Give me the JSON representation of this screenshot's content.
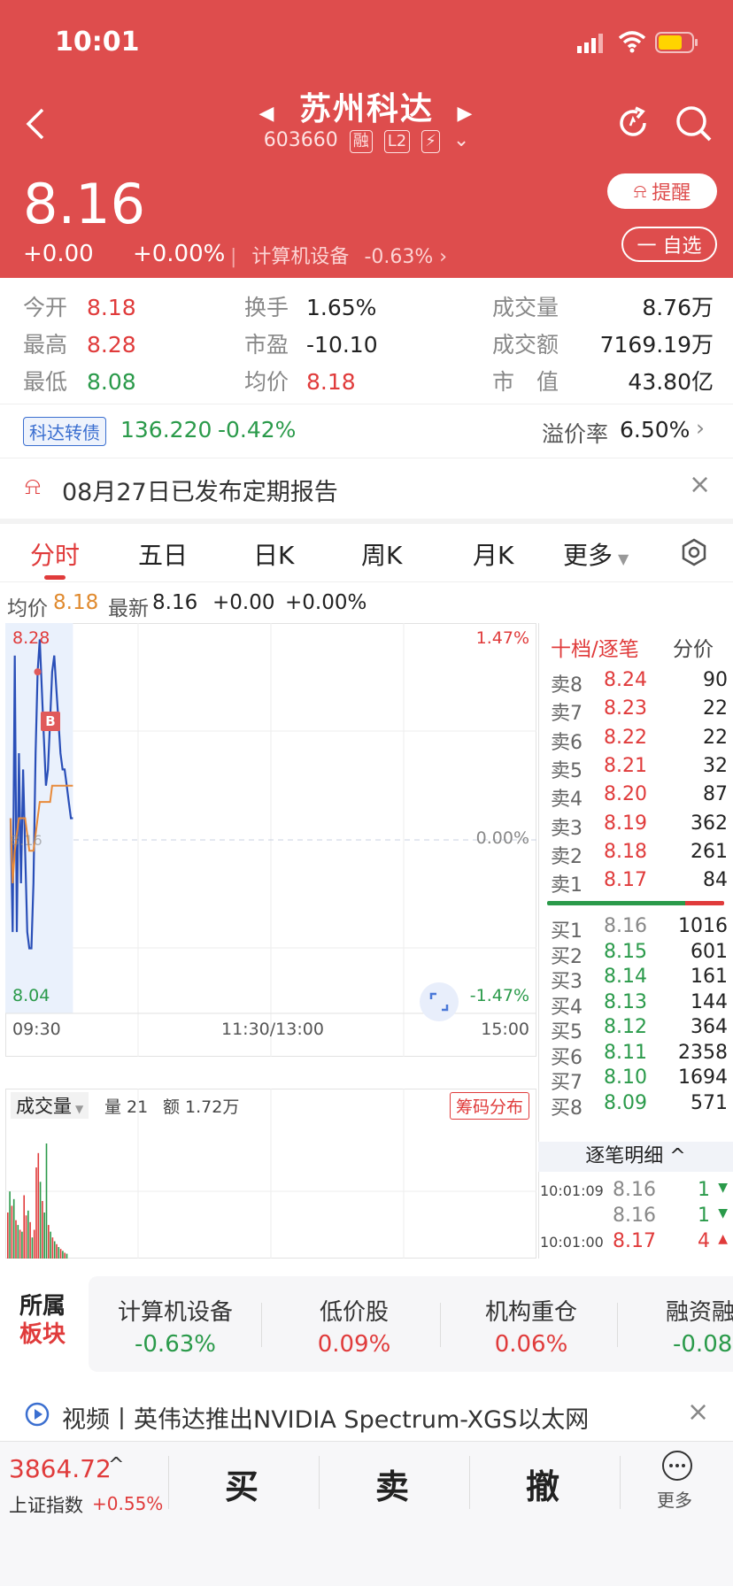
{
  "status": {
    "time": "10:01"
  },
  "header": {
    "name": "苏州科达",
    "code": "603660",
    "tags": [
      "融",
      "L2",
      "⚡"
    ],
    "price": "8.16",
    "change": "+0.00",
    "change_pct": "+0.00%",
    "sector": "计算机设备",
    "sector_pct": "-0.63%",
    "remind_label": "提醒",
    "watch_label": "一 自选"
  },
  "stats": {
    "open_k": "今开",
    "open_v": "8.18",
    "high_k": "最高",
    "high_v": "8.28",
    "low_k": "最低",
    "low_v": "8.08",
    "turnover_k": "换手",
    "turnover_v": "1.65%",
    "pe_k": "市盈",
    "pe_v": "-10.10",
    "avg_k": "均价",
    "avg_v": "8.18",
    "volume_k": "成交量",
    "volume_v": "8.76万",
    "amount_k": "成交额",
    "amount_v": "7169.19万",
    "mcap_k": "市　值",
    "mcap_v": "43.80亿"
  },
  "convertible": {
    "tag": "科达转债",
    "price": "136.220",
    "pct": "-0.42%",
    "premium_k": "溢价率",
    "premium_v": "6.50%"
  },
  "notice": {
    "text": "08月27日已发布定期报告"
  },
  "tabs": [
    "分时",
    "五日",
    "日K",
    "周K",
    "月K",
    "更多"
  ],
  "avgline": {
    "avg_k": "均价",
    "avg_v": "8.18",
    "last_k": "最新",
    "last_v": "8.16",
    "chg": "+0.00",
    "pct": "+0.00%"
  },
  "chart": {
    "top_price": "8.28",
    "bottom_price": "8.04",
    "top_pct": "1.47%",
    "bottom_pct": "-1.47%",
    "mid_pct": "0.00%",
    "mid_price": "8.16",
    "time_start": "09:30",
    "time_mid": "11:30/13:00",
    "time_end": "15:00",
    "marker": "B"
  },
  "chart_data": {
    "type": "line",
    "ylim": [
      8.04,
      8.28
    ],
    "x": [
      0,
      1,
      2,
      3,
      4,
      5,
      6,
      7,
      8,
      9,
      10,
      11,
      12,
      13,
      14,
      15,
      16,
      17,
      18,
      19,
      20,
      21,
      22,
      23,
      24,
      25,
      26,
      27,
      28,
      29,
      30
    ],
    "series": [
      {
        "values": [
          8.16,
          8.09,
          8.26,
          8.09,
          8.2,
          8.12,
          8.19,
          8.14,
          8.09,
          8.08,
          8.08,
          8.12,
          8.2,
          8.25,
          8.27,
          8.24,
          8.21,
          8.18,
          8.19,
          8.22,
          8.25,
          8.26,
          8.24,
          8.22,
          8.2,
          8.19,
          8.19,
          8.18,
          8.17,
          8.16,
          8.16
        ]
      },
      {
        "values": [
          8.16,
          8.12,
          8.14,
          8.15,
          8.16,
          8.16,
          8.16,
          8.16,
          8.15,
          8.14,
          8.14,
          8.14,
          8.15,
          8.16,
          8.17,
          8.17,
          8.17,
          8.17,
          8.17,
          8.17,
          8.18,
          8.18,
          8.18,
          8.18,
          8.18,
          8.18,
          8.18,
          8.18,
          8.18,
          8.18,
          8.18
        ]
      }
    ]
  },
  "volume": {
    "label": "成交量",
    "qty": "量 21",
    "amt": "额 1.72万",
    "chip_btn": "筹码分布",
    "bars": [
      48,
      70,
      55,
      62,
      40,
      35,
      30,
      28,
      66,
      45,
      50,
      38,
      22,
      30,
      95,
      110,
      80,
      60,
      48,
      120,
      35,
      28,
      22,
      18,
      15,
      12,
      10,
      8,
      6,
      5
    ],
    "colors": [
      "r",
      "g",
      "r",
      "g",
      "r",
      "g",
      "r",
      "g",
      "r",
      "r",
      "g",
      "r",
      "g",
      "r",
      "r",
      "r",
      "g",
      "r",
      "g",
      "g",
      "r",
      "g",
      "r",
      "g",
      "r",
      "g",
      "r",
      "g",
      "r",
      "g"
    ]
  },
  "orderbook": {
    "title": "十档/逐笔",
    "side": "分价",
    "asks": [
      {
        "k": "卖8",
        "p": "8.24",
        "v": "90"
      },
      {
        "k": "卖7",
        "p": "8.23",
        "v": "22"
      },
      {
        "k": "卖6",
        "p": "8.22",
        "v": "22"
      },
      {
        "k": "卖5",
        "p": "8.21",
        "v": "32"
      },
      {
        "k": "卖4",
        "p": "8.20",
        "v": "87"
      },
      {
        "k": "卖3",
        "p": "8.19",
        "v": "362"
      },
      {
        "k": "卖2",
        "p": "8.18",
        "v": "261"
      },
      {
        "k": "卖1",
        "p": "8.17",
        "v": "84"
      }
    ],
    "bids": [
      {
        "k": "买1",
        "p": "8.16",
        "v": "1016"
      },
      {
        "k": "买2",
        "p": "8.15",
        "v": "601"
      },
      {
        "k": "买3",
        "p": "8.14",
        "v": "161"
      },
      {
        "k": "买4",
        "p": "8.13",
        "v": "144"
      },
      {
        "k": "买5",
        "p": "8.12",
        "v": "364"
      },
      {
        "k": "买6",
        "p": "8.11",
        "v": "2358"
      },
      {
        "k": "买7",
        "p": "8.10",
        "v": "1694"
      },
      {
        "k": "买8",
        "p": "8.09",
        "v": "571"
      }
    ],
    "detail_label": "逐笔明细 ^",
    "ticks": [
      {
        "t": "10:01:09",
        "p": "8.16",
        "v": "1"
      },
      {
        "t": "",
        "p": "8.16",
        "v": "1"
      },
      {
        "t": "10:01:00",
        "p": "8.17",
        "v": "4"
      }
    ]
  },
  "sectors": {
    "label1": "所属",
    "label2": "板块",
    "items": [
      {
        "name": "计算机设备",
        "pct": "-0.63%"
      },
      {
        "name": "低价股",
        "pct": "0.09%"
      },
      {
        "name": "机构重仓",
        "pct": "0.06%"
      },
      {
        "name": "融资融",
        "pct": "-0.08"
      }
    ]
  },
  "news": {
    "text": "视频丨英伟达推出NVIDIA Spectrum-XGS以太网"
  },
  "bottom": {
    "index_v": "3864.72",
    "index_name": "上证指数",
    "index_pct": "+0.55%",
    "buy": "买",
    "sell": "卖",
    "cancel": "撤",
    "more": "更多"
  }
}
